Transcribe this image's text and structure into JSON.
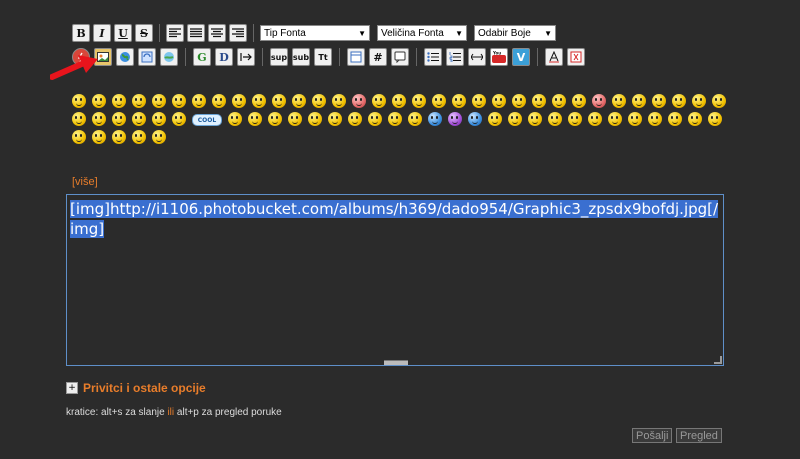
{
  "toolbar_row1": {
    "bold": "B",
    "italic": "I",
    "underline": "U",
    "strike": "S",
    "font_type": "Tip Fonta",
    "font_size": "Veličina Fonta",
    "font_color": "Odabir Boje"
  },
  "toolbar_row2": {
    "google": "G",
    "wiki": "D",
    "sup": "sup",
    "sub": "sub",
    "tt": "Tt",
    "hash": "#"
  },
  "smilies": {
    "cool_label": "COOL"
  },
  "more_link": "[više]",
  "editor": {
    "text_prefix": "[img]",
    "text_url": "http://i1106.photobucket.com/albums/h369/dado954/Graphic3_zpsdx9bofdj.jp",
    "text_suffix": "g[/img]"
  },
  "attachments": {
    "icon": "+",
    "label": "Privitci i ostale opcije"
  },
  "shortcuts": {
    "part1": "kratice: alt+s za slanje",
    "or": "ili",
    "part2": "alt+p za pregled poruke"
  },
  "buttons": {
    "send": "Pošalji",
    "preview": "Pregled"
  },
  "colors": {
    "accent": "#e87d2b",
    "selection": "#3a6fd0",
    "arrow": "#e8141c"
  }
}
